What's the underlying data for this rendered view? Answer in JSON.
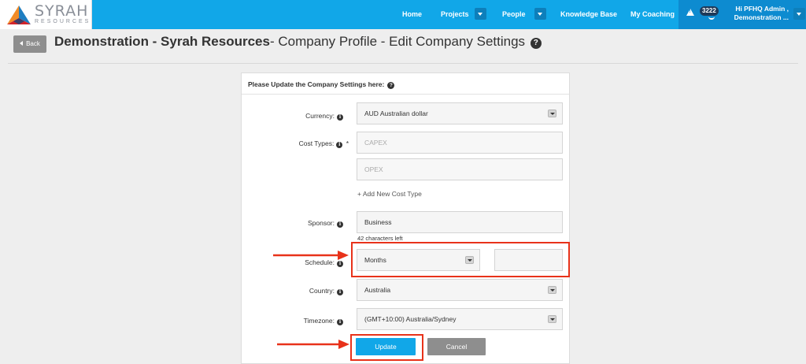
{
  "brand": {
    "name": "SYRAH",
    "sub": "RESOURCES"
  },
  "nav": {
    "home": "Home",
    "projects": "Projects",
    "people": "People",
    "knowledge_base": "Knowledge Base",
    "my_coaching": "My Coaching",
    "notification_count": "3222",
    "user_line1": "Hi PFHQ Admin ,",
    "user_line2": "Demonstration ..."
  },
  "header": {
    "back_label": "Back",
    "title_bold": "Demonstration - Syrah Resources",
    "title_rest": "- Company Profile - Edit Company Settings"
  },
  "form": {
    "heading": "Please Update the Company Settings here:",
    "currency_label": "Currency:",
    "currency_value": "AUD Australian dollar",
    "cost_types_label": "Cost Types:",
    "required_mark": "*",
    "cost_type_1_placeholder": "CAPEX",
    "cost_type_2_placeholder": "OPEX",
    "add_cost_type": "+ Add New Cost Type",
    "sponsor_label": "Sponsor:",
    "sponsor_value": "Business",
    "sponsor_hint": "42 characters left",
    "schedule_label": "Schedule:",
    "schedule_unit": "Months",
    "schedule_value": "",
    "country_label": "Country:",
    "country_value": "Australia",
    "timezone_label": "Timezone:",
    "timezone_value": "(GMT+10:00) Australia/Sydney",
    "update_label": "Update",
    "cancel_label": "Cancel"
  },
  "colors": {
    "nav_blue": "#11a7e8",
    "annotation_red": "#e8321a",
    "button_grey": "#8e8e8e"
  }
}
